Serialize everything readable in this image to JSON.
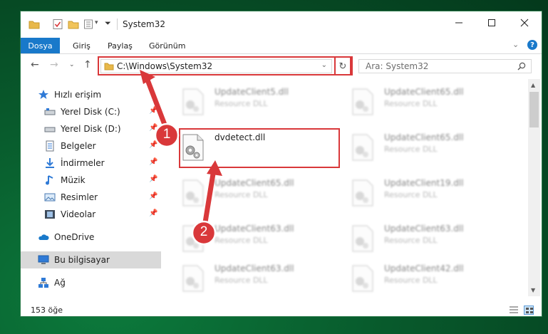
{
  "window": {
    "title": "System32",
    "controls": [
      "minimize",
      "maximize",
      "close"
    ]
  },
  "ribbon": {
    "file_tab": "Dosya",
    "tabs": [
      "Giriş",
      "Paylaş",
      "Görünüm"
    ]
  },
  "navigation": {
    "address": "C:\\Windows\\System32",
    "search_placeholder": "Ara: System32"
  },
  "sidebar": {
    "items": [
      {
        "label": "Hızlı erişim",
        "icon": "star-icon",
        "pinned": false
      },
      {
        "label": "Yerel Disk (C:)",
        "icon": "drive-icon",
        "pinned": true
      },
      {
        "label": "Yerel Disk (D:)",
        "icon": "drive-icon",
        "pinned": true
      },
      {
        "label": "Belgeler",
        "icon": "document-icon",
        "pinned": true
      },
      {
        "label": "İndirmeler",
        "icon": "download-icon",
        "pinned": true
      },
      {
        "label": "Müzik",
        "icon": "music-icon",
        "pinned": true
      },
      {
        "label": "Resimler",
        "icon": "pictures-icon",
        "pinned": true
      },
      {
        "label": "Videolar",
        "icon": "video-icon",
        "pinned": true
      },
      {
        "label": "OneDrive",
        "icon": "cloud-icon",
        "pinned": false
      },
      {
        "label": "Bu bilgisayar",
        "icon": "computer-icon",
        "pinned": false,
        "selected": true
      },
      {
        "label": "Ağ",
        "icon": "network-icon",
        "pinned": false
      }
    ]
  },
  "files": {
    "left_column": [
      {
        "name": "UpdateClient5.dll",
        "description": "Resource DLL",
        "blurred": true
      },
      {
        "name": "dvdetect.dll",
        "description": "",
        "blurred": false,
        "highlighted": true
      },
      {
        "name": "UpdateClient65.dll",
        "description": "Resource DLL",
        "blurred": true
      },
      {
        "name": "UpdateClient63.dll",
        "description": "Resource DLL",
        "blurred": true
      },
      {
        "name": "UpdateClient63.dll",
        "description": "Resource DLL",
        "blurred": true
      }
    ],
    "right_column": [
      {
        "name": "UpdateClient65.dll",
        "description": "Resource DLL",
        "blurred": true
      },
      {
        "name": "UpdateClient65.dll",
        "description": "Resource DLL",
        "blurred": true
      },
      {
        "name": "UpdateClient19.dll",
        "description": "Resource DLL",
        "blurred": true
      },
      {
        "name": "UpdateClient63.dll",
        "description": "Resource DLL",
        "blurred": true
      },
      {
        "name": "UpdateClient42.dll",
        "description": "Resource DLL",
        "blurred": true
      }
    ]
  },
  "status": {
    "item_count": "153 öğe"
  },
  "annotations": {
    "step1": "1",
    "step2": "2",
    "color": "#d9383a"
  },
  "colors": {
    "accent": "#1979ca",
    "background": "#085a2c"
  }
}
